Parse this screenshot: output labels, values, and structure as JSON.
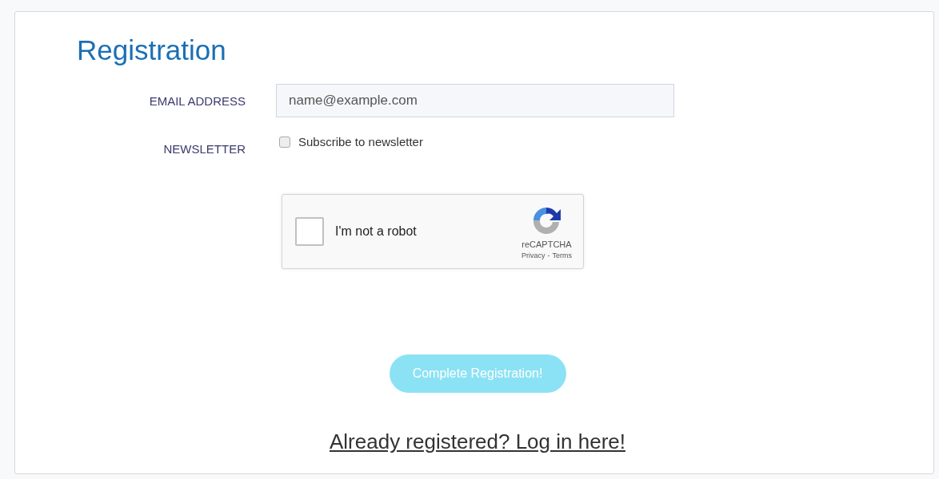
{
  "title": "Registration",
  "email": {
    "label": "EMAIL ADDRESS",
    "placeholder": "name@example.com"
  },
  "newsletter": {
    "label": "NEWSLETTER",
    "option": "Subscribe to newsletter",
    "checked": false
  },
  "captcha": {
    "label": "I'm not a robot",
    "checked": false,
    "brand": "reCAPTCHA",
    "privacy": "Privacy",
    "separator": "-",
    "terms": "Terms"
  },
  "submit": {
    "label": "Complete Registration!",
    "disabled": true
  },
  "login_link": "Already registered? Log in here!"
}
